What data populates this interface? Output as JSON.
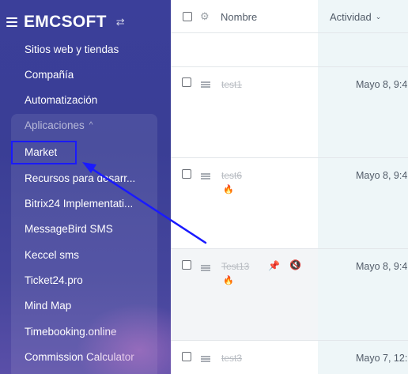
{
  "sidebar": {
    "brand": "EMCSOFT",
    "items": [
      {
        "label": "Sitios web y tiendas"
      },
      {
        "label": "Compañía"
      },
      {
        "label": "Automatización"
      }
    ],
    "apps_group": {
      "label": "Aplicaciones",
      "items": [
        {
          "label": "Market"
        },
        {
          "label": "Recursos para desarr..."
        },
        {
          "label": "Bitrix24 Implementati..."
        },
        {
          "label": "MessageBird SMS"
        },
        {
          "label": "Keccel sms"
        },
        {
          "label": "Ticket24.pro"
        },
        {
          "label": "Mind Map"
        },
        {
          "label": "Timebooking.online"
        },
        {
          "label": "Commission Calculator"
        }
      ]
    }
  },
  "table": {
    "columns": {
      "name": "Nombre",
      "activity": "Actividad"
    },
    "rows": [
      {
        "name": "test1",
        "date": "Mayo 8, 9:4",
        "hot": false,
        "pinned": false
      },
      {
        "name": "test6",
        "date": "Mayo 8, 9:4",
        "hot": true,
        "pinned": false
      },
      {
        "name": "Test13",
        "date": "Mayo 8, 9:4",
        "hot": true,
        "pinned": true
      },
      {
        "name": "test3",
        "date": "Mayo 7, 12:",
        "hot": false,
        "pinned": false
      }
    ]
  },
  "colors": {
    "sidebar": "#3b3f9a",
    "highlight_box": "#1a1aff",
    "annotation_arrow": "#1a1aff",
    "hot_icon": "#f36f2a"
  }
}
